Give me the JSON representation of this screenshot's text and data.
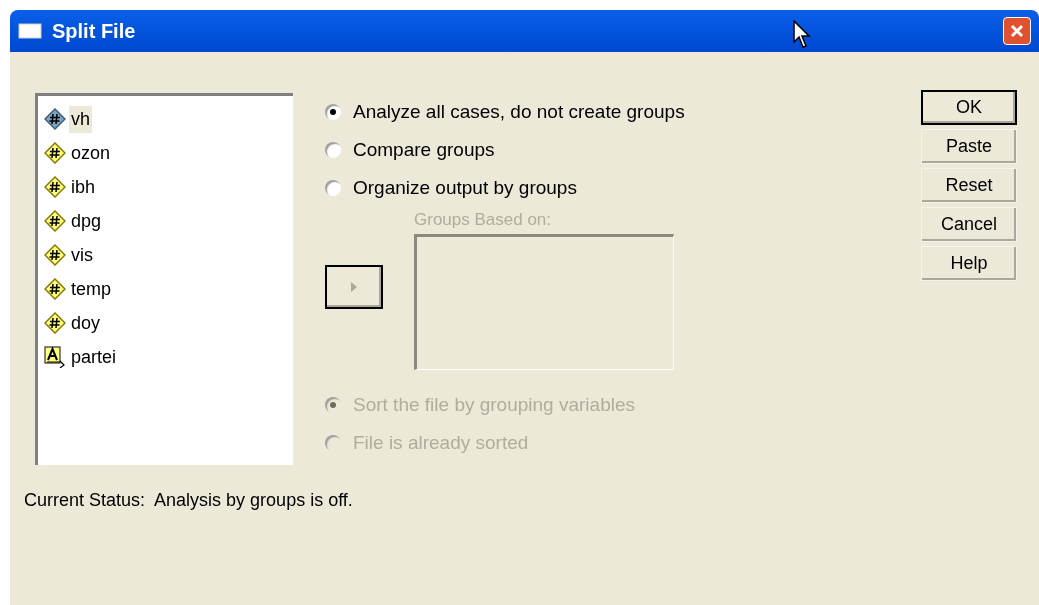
{
  "window": {
    "title": "Split File"
  },
  "variables": [
    {
      "name": "vh",
      "kind": "numeric",
      "selected": true
    },
    {
      "name": "ozon",
      "kind": "numeric",
      "selected": false
    },
    {
      "name": "ibh",
      "kind": "numeric",
      "selected": false
    },
    {
      "name": "dpg",
      "kind": "numeric",
      "selected": false
    },
    {
      "name": "vis",
      "kind": "numeric",
      "selected": false
    },
    {
      "name": "temp",
      "kind": "numeric",
      "selected": false
    },
    {
      "name": "doy",
      "kind": "numeric",
      "selected": false
    },
    {
      "name": "partei",
      "kind": "string",
      "selected": false
    }
  ],
  "mode_options": [
    {
      "label": "Analyze all cases, do not create groups",
      "selected": true,
      "disabled": false
    },
    {
      "label": "Compare groups",
      "selected": false,
      "disabled": false
    },
    {
      "label": "Organize output by groups",
      "selected": false,
      "disabled": false
    }
  ],
  "groups_based_on": {
    "label": "Groups Based on:",
    "disabled": true
  },
  "move_button": {
    "disabled": true
  },
  "sort_options": [
    {
      "label": "Sort the file by grouping variables",
      "selected": true,
      "disabled": true
    },
    {
      "label": "File is already sorted",
      "selected": false,
      "disabled": true
    }
  ],
  "buttons": [
    {
      "label": "OK",
      "default": true
    },
    {
      "label": "Paste",
      "default": false
    },
    {
      "label": "Reset",
      "default": false
    },
    {
      "label": "Cancel",
      "default": false
    },
    {
      "label": "Help",
      "default": false
    }
  ],
  "status": "Current Status:  Analysis by groups is off."
}
